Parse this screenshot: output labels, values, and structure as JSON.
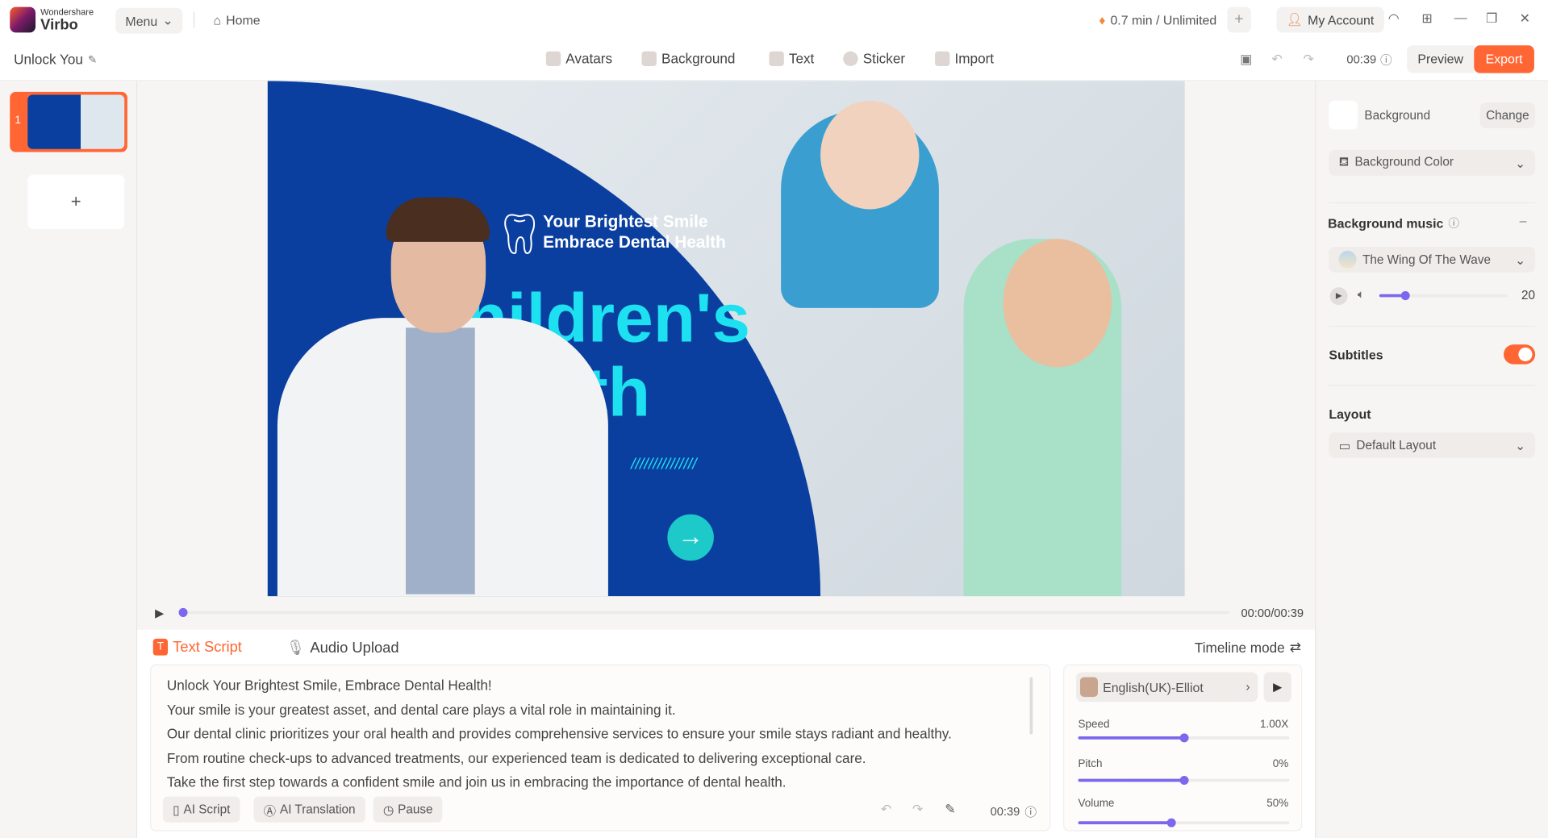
{
  "app": {
    "brand_top": "Wondershare",
    "brand": "Virbo",
    "menu": "Menu",
    "home": "Home",
    "credits": "0.7 min / Unlimited",
    "account": "My Account"
  },
  "toolbar": {
    "project": "Unlock You",
    "tools": [
      {
        "label": "Avatars",
        "icon": "avatar-icon"
      },
      {
        "label": "Background",
        "icon": "background-icon"
      },
      {
        "label": "Text",
        "icon": "text-icon"
      },
      {
        "label": "Sticker",
        "icon": "sticker-icon"
      },
      {
        "label": "Import",
        "icon": "import-icon"
      }
    ],
    "duration": "00:39",
    "preview": "Preview",
    "export": "Export"
  },
  "slides": {
    "items": [
      {
        "number": "1"
      }
    ],
    "add": "+"
  },
  "canvas": {
    "headline1": "Your Brightest Smile",
    "headline2": "Embrace Dental Health",
    "big1": "hildren's",
    "big2": "d      health",
    "slashes": "///////////////"
  },
  "player": {
    "time": "00:00/00:39",
    "progress": 0
  },
  "script": {
    "tabs": [
      {
        "label": "Text Script",
        "active": true
      },
      {
        "label": "Audio Upload",
        "active": false
      }
    ],
    "timeline_mode": "Timeline mode",
    "lines": [
      "Unlock Your Brightest Smile, Embrace Dental Health!",
      "Your smile is your greatest asset, and dental care plays a vital role in maintaining it.",
      "Our dental clinic prioritizes your oral health and provides comprehensive services to ensure your smile stays radiant and healthy.",
      "From routine check-ups to advanced treatments, our experienced team is dedicated to delivering exceptional care.",
      "Take the first step towards a confident smile and join us in embracing the importance of dental health."
    ],
    "buttons": [
      "AI Script",
      "AI Translation",
      "Pause"
    ],
    "duration": "00:39"
  },
  "voice": {
    "name": "English(UK)-Elliot",
    "speed_label": "Speed",
    "speed": "1.00X",
    "speed_pct": 50,
    "pitch_label": "Pitch",
    "pitch": "0%",
    "pitch_pct": 50,
    "volume_label": "Volume",
    "volume": "50%",
    "volume_pct": 44
  },
  "panel": {
    "background": "Background",
    "change": "Change",
    "bg_color": "Background Color",
    "music_title": "Background music",
    "music": "The Wing Of The Wave",
    "music_volume": "20",
    "music_volume_pct": 20,
    "subtitles": "Subtitles",
    "subtitles_on": true,
    "layout_title": "Layout",
    "layout": "Default Layout"
  },
  "colors": {
    "accent": "#ff6633",
    "slider": "#7b68ee",
    "canvas_blue": "#0a3fa0",
    "cyan": "#1de0f0"
  }
}
